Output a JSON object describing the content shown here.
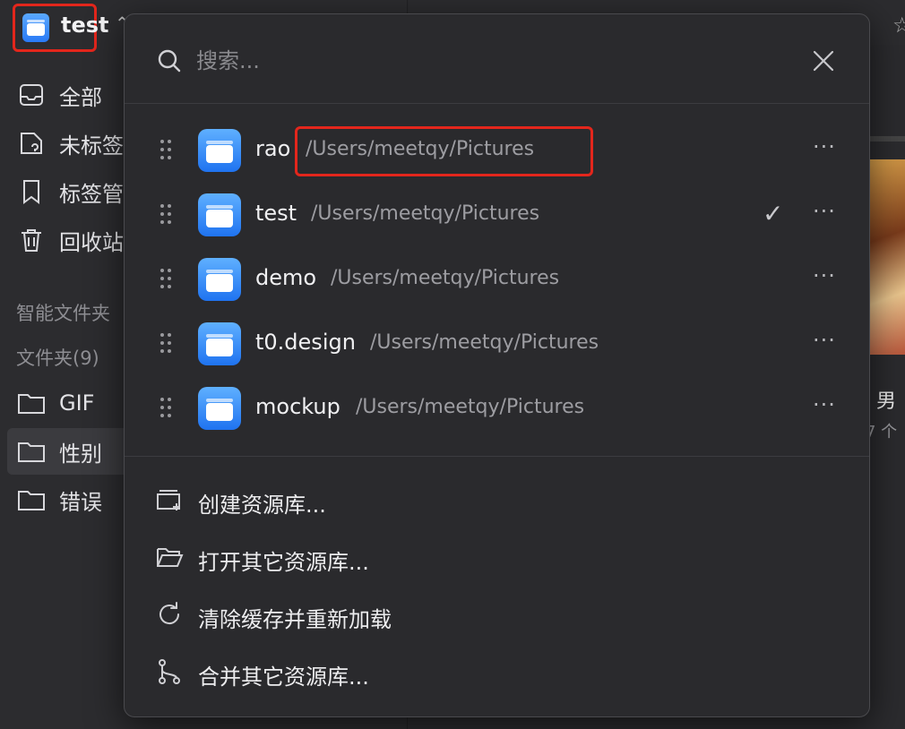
{
  "app": {
    "current_library": "test"
  },
  "sidebar": {
    "items": [
      {
        "label": "全部",
        "icon": "inbox-icon"
      },
      {
        "label": "未标签",
        "icon": "tag-question-icon"
      },
      {
        "label": "标签管",
        "icon": "bookmark-icon"
      },
      {
        "label": "回收站",
        "icon": "trash-icon"
      }
    ],
    "smart_folders_label": "智能文件夹",
    "folders_label": "文件夹(9)",
    "folders": [
      {
        "label": "GIF",
        "icon": "folder-icon"
      },
      {
        "label": "性别",
        "icon": "folder-icon"
      },
      {
        "label": "错误",
        "icon": "folder-icon"
      }
    ]
  },
  "content": {
    "card_title": "男",
    "card_count": "7 个"
  },
  "popup": {
    "search": {
      "placeholder": "搜索..."
    },
    "libraries": [
      {
        "name": "rao",
        "path": "/Users/meetqy/Pictures",
        "selected": false
      },
      {
        "name": "test",
        "path": "/Users/meetqy/Pictures",
        "selected": true
      },
      {
        "name": "demo",
        "path": "/Users/meetqy/Pictures",
        "selected": false
      },
      {
        "name": "t0.design",
        "path": "/Users/meetqy/Pictures",
        "selected": false
      },
      {
        "name": "mockup",
        "path": "/Users/meetqy/Pictures",
        "selected": false
      }
    ],
    "more_label": "···",
    "check_mark": "✓",
    "actions": [
      {
        "label": "创建资源库...",
        "icon": "create-library-icon"
      },
      {
        "label": "打开其它资源库...",
        "icon": "open-folder-icon"
      },
      {
        "label": "清除缓存并重新加载",
        "icon": "reload-icon"
      },
      {
        "label": "合并其它资源库...",
        "icon": "merge-icon"
      }
    ]
  },
  "colors": {
    "highlight": "#e3261c",
    "accent": "#2a7af5",
    "background": "#2b2b2e"
  }
}
